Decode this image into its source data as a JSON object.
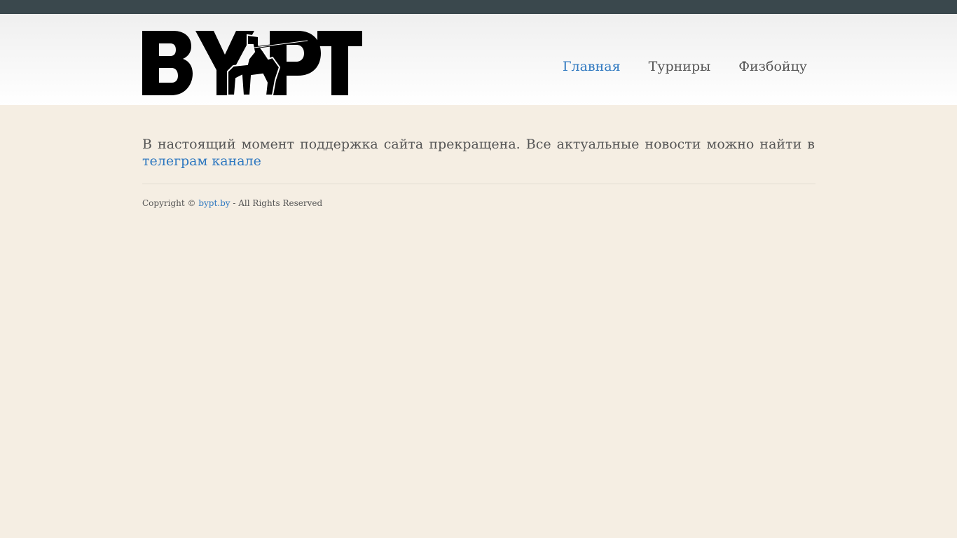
{
  "header": {
    "logo_text": "BYPT",
    "nav": [
      {
        "label": "Главная",
        "active": true
      },
      {
        "label": "Турниры",
        "active": false
      },
      {
        "label": "Физбойцу",
        "active": false
      }
    ]
  },
  "main": {
    "notice_text": "В настоящий момент поддержка сайта прекращена. Все актуальные новости можно найти в ",
    "notice_link": "телеграм канале"
  },
  "footer": {
    "copyright_prefix": "Copyright © ",
    "copyright_link": "bypt.by",
    "copyright_suffix": " - All Rights Reserved"
  },
  "colors": {
    "topbar": "#3a484d",
    "link": "#2e78c0",
    "background": "#f5eee3"
  }
}
